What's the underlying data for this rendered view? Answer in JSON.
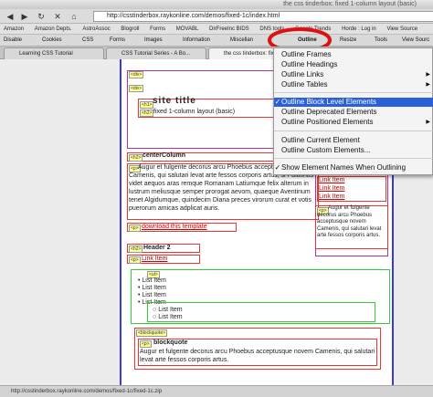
{
  "window_title": "the css tinderbox: fixed 1-column layout (basic)",
  "url": "http://csstinderbox.raykonline.com/demos/fixed-1c/index.html",
  "bookmarks": [
    "Amazon",
    "Amazon Depts.",
    "AstroAssoc",
    "Blogroll",
    "Forms",
    "MOVABL",
    "DirFreeInc BIDS",
    "DNS tools",
    "Google Trends",
    "Horde : Log in",
    "View Source"
  ],
  "devbar": {
    "disable": "Disable",
    "cookies": "Cookies",
    "css": "CSS",
    "forms": "Forms",
    "images": "Images",
    "information": "Information",
    "miscellaneous": "Miscellan",
    "outline": "Outline",
    "resize": "Resize",
    "tools": "Tools",
    "view_source": "View Sourc"
  },
  "tabs": [
    "Learning CSS Tutorial",
    "CSS Tutorial Series - A Bo...",
    "the css tinderbox: fixe"
  ],
  "page": {
    "tags": {
      "div": "<div>",
      "h1": "<h1>",
      "h2": "<h2>",
      "p": "<p>",
      "ul": "<ul>",
      "blockquote": "<blockquote>"
    },
    "site_title": "site title",
    "subtitle": "fixed 1-column layout (basic)",
    "center_column": "centerColumn",
    "para": "Augur et fulgente decorus arcu Phoebus acceptusque novem Camenis, qui salutari levat arte fessos corporis artus, si Palatinas videt aequos aras remque Romanam Latiumque felix alterum in lustrum meliusque semper prorogat aevom, quaeque Aventinum tenet Algidumque, quindecim Diana preces virorum curat et votis puerorum amicas adplicat auris.",
    "download": "download this template",
    "header2": "Header 2",
    "link_item": "Link Item",
    "list_items": [
      "List Item",
      "List Item",
      "List Item",
      "List Item"
    ],
    "nested_items": [
      "List Item",
      "List Item"
    ],
    "blockquote_title": "blockquote",
    "blockquote_text": "Augur et fulgente decorus arcu Phoebus acceptusque novem Camenis, qui salutari levat arte fessos corporis artus.",
    "side_links": [
      "Link Item",
      "Link Item",
      "Link Item"
    ],
    "side_para": "Augur et fulgente decorus arcu Phoebus acceptusque novem Camenis, qui salutari levat arte fessos corporis artus."
  },
  "menu": {
    "items": [
      {
        "label": "Outline Frames",
        "check": "",
        "arrow": ""
      },
      {
        "label": "Outline Headings",
        "check": "",
        "arrow": ""
      },
      {
        "label": "Outline Links",
        "check": "",
        "arrow": "▶"
      },
      {
        "label": "Outline Tables",
        "check": "",
        "arrow": "▶"
      },
      {
        "label": "Outline Block Level Elements",
        "check": "✓",
        "arrow": ""
      },
      {
        "label": "Outline Deprecated Elements",
        "check": "",
        "arrow": ""
      },
      {
        "label": "Outline Positioned Elements",
        "check": "",
        "arrow": "▶"
      },
      {
        "label": "Outline Current Element",
        "check": "",
        "arrow": ""
      },
      {
        "label": "Outline Custom Elements...",
        "check": "",
        "arrow": ""
      },
      {
        "label": "Show Element Names When Outlining",
        "check": "✓",
        "arrow": ""
      }
    ]
  },
  "status": "http://csstinderbox.raykonline.com/demos/fixed-1c/fixed-1c.zip",
  "colors": {
    "accent": "#2a60d8",
    "outline_red": "#e33333",
    "outline_green": "#33cc33",
    "outline_blue": "#3a3adb",
    "highlight_circle": "#e01010"
  }
}
